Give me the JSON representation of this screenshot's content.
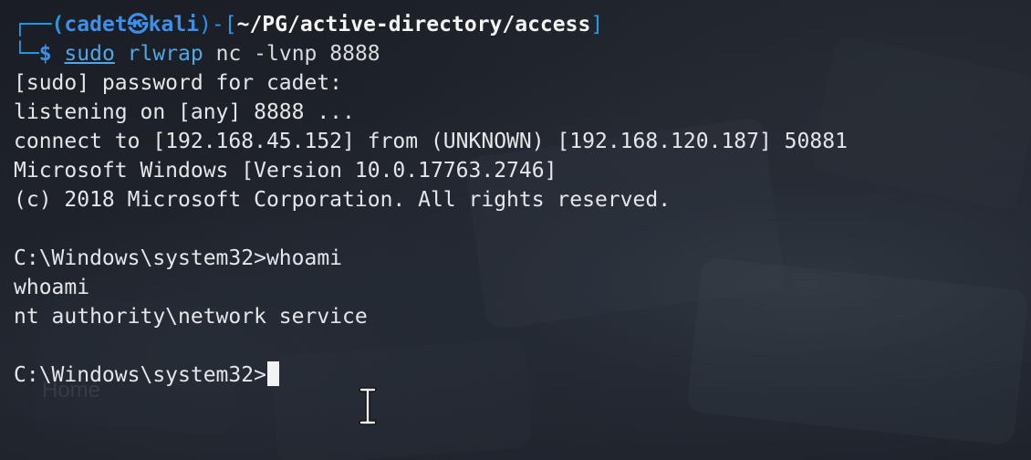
{
  "prompt": {
    "corner": "┌──",
    "open_paren": "(",
    "user": "cadet",
    "separator": "㉿",
    "host": "kali",
    "close_paren_dash": ")-[",
    "cwd": "~/PG/active-directory/access",
    "close_bracket": "]",
    "bottom_corner": "└─",
    "dollar": "$",
    "sudo": "sudo",
    "program": "rlwrap",
    "args": "nc -lvnp 8888"
  },
  "output": [
    "[sudo] password for cadet:",
    "listening on [any] 8888 ...",
    "connect to [192.168.45.152] from (UNKNOWN) [192.168.120.187] 50881",
    "Microsoft Windows [Version 10.0.17763.2746]",
    "(c) 2018 Microsoft Corporation. All rights reserved.",
    "",
    "C:\\Windows\\system32>whoami",
    "whoami",
    "nt authority\\network service",
    ""
  ],
  "current_prompt": "C:\\Windows\\system32>",
  "background_label": "Home",
  "colors": {
    "background": "#1b1f27",
    "prompt_blue": "#1f9cf0",
    "command_blue": "#4fa6e8",
    "text": "#e4e6ea",
    "cursor": "#f2f2f2"
  },
  "icons": {
    "cursor": "block-cursor",
    "mouse_pointer": "ibeam-cursor-icon"
  }
}
